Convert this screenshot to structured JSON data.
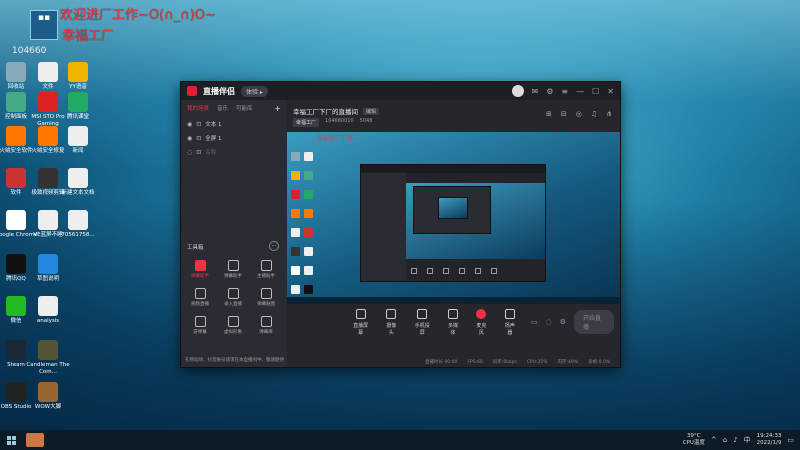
{
  "overlay": {
    "line1": "欢迎进厂工作~O(∩_∩)O~",
    "line2": "幸福工厂",
    "number": "104660"
  },
  "desktop_icons": [
    {
      "label": "回收站",
      "color": "#8ab"
    },
    {
      "label": "文件",
      "color": "#eee"
    },
    {
      "label": "YY语音",
      "color": "#f0b400"
    },
    {
      "label": "控制面板",
      "color": "#4a8"
    },
    {
      "label": "MSI STD Pro Gaming",
      "color": "#d22"
    },
    {
      "label": "腾讯课堂",
      "color": "#2a6"
    },
    {
      "label": "火绒安全软件",
      "color": "#f70"
    },
    {
      "label": "火绒安全修复",
      "color": "#f70"
    },
    {
      "label": "新闻",
      "color": "#eee"
    },
    {
      "label": "软件",
      "color": "#c33"
    },
    {
      "label": "极致视频剪辑",
      "color": "#333"
    },
    {
      "label": "新建文本文档",
      "color": "#eee"
    },
    {
      "label": "Google Chrome",
      "color": "#fff"
    },
    {
      "label": "VE蓝屏不睡",
      "color": "#eee"
    },
    {
      "label": "70561758...",
      "color": "#eee"
    },
    {
      "label": "腾讯QQ",
      "color": "#111"
    },
    {
      "label": "草图说明",
      "color": "#28d"
    },
    {
      "label": "微信",
      "color": "#2b2"
    },
    {
      "label": "analysis",
      "color": "#eee"
    },
    {
      "label": "Steam",
      "color": "#1b2838"
    },
    {
      "label": "Candleman The Com...",
      "color": "#553"
    },
    {
      "label": "OBS Studio",
      "color": "#222"
    },
    {
      "label": "WOW大脚",
      "color": "#963"
    }
  ],
  "app": {
    "brand": "直播伴侣",
    "version_pill": "体验 ▸",
    "left_tabs": [
      "我的场景",
      "音乐",
      "可能库"
    ],
    "scenes": [
      {
        "name": "文本 1"
      },
      {
        "name": "全屏 1"
      },
      {
        "name": "名称"
      }
    ],
    "tools_heading": "工具箱",
    "tools": [
      {
        "label": "弹幕助手",
        "active": true
      },
      {
        "label": "弹幕助手",
        "active": false
      },
      {
        "label": "主播助手",
        "active": false
      },
      {
        "label": "视频直播",
        "active": false
      },
      {
        "label": "录入直播",
        "active": false
      },
      {
        "label": "弹幕贴图",
        "active": false
      },
      {
        "label": "游弹幕",
        "active": false
      },
      {
        "label": "虚拟形象",
        "active": false
      },
      {
        "label": "弹幕库",
        "active": false
      }
    ],
    "hint_text": "礼物动效、抖音账号请求在本直播间中、敬请期待",
    "room_title": "幸福工厂下厂的直播间",
    "edit_label": "编辑",
    "room_tag": "幸福工厂",
    "room_id": "104660010",
    "fans": "5048",
    "preview_overlay": "欢迎进厂工作~",
    "controls": [
      {
        "label": "直播屏幕",
        "red": false
      },
      {
        "label": "摄像头",
        "red": false
      },
      {
        "label": "手机投屏",
        "red": false
      },
      {
        "label": "多媒体",
        "red": false
      },
      {
        "label": "麦克风",
        "red": true
      },
      {
        "label": "扬声器",
        "red": false
      }
    ],
    "go_live": "开始直播",
    "status": [
      "直播时长 00:00",
      "FPS:60",
      "码率:0kbps",
      "CPU:35%",
      "内存:49%",
      "丢帧:0.0%"
    ]
  },
  "taskbar": {
    "weather": "39°C",
    "weather_desc": "CPU温度",
    "time": "19:24:33",
    "date": "2022/1/9"
  }
}
